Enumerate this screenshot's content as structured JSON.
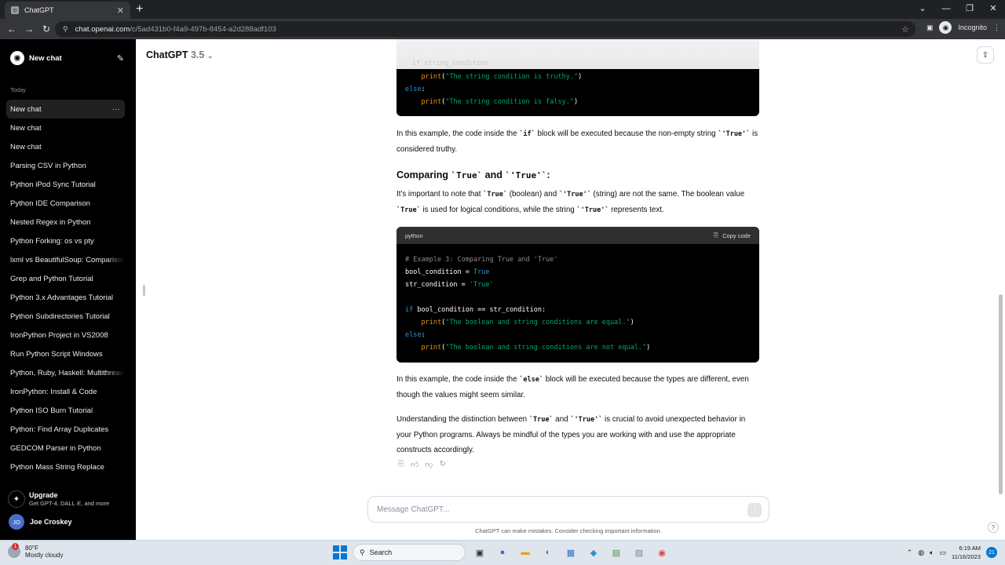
{
  "browser": {
    "tab_title": "ChatGPT",
    "url_host": "chat.openai.com",
    "url_path": "/c/5ad431b0-f4a9-497b-8454-a2d288adf103",
    "incognito_label": "Incognito"
  },
  "sidebar": {
    "new_chat": "New chat",
    "section_label": "Today",
    "items": [
      {
        "label": "New chat"
      },
      {
        "label": "New chat"
      },
      {
        "label": "New chat"
      },
      {
        "label": "Parsing CSV in Python"
      },
      {
        "label": "Python iPod Sync Tutorial"
      },
      {
        "label": "Python IDE Comparison"
      },
      {
        "label": "Nested Regex in Python"
      },
      {
        "label": "Python Forking: os vs pty"
      },
      {
        "label": "lxml vs BeautifulSoup: Comparison"
      },
      {
        "label": "Grep and Python Tutorial"
      },
      {
        "label": "Python 3.x Advantages Tutorial"
      },
      {
        "label": "Python Subdirectories Tutorial"
      },
      {
        "label": "IronPython Project in VS2008"
      },
      {
        "label": "Run Python Script Windows"
      },
      {
        "label": "Python, Ruby, Haskell: Multithreading"
      },
      {
        "label": "IronPython: Install & Code"
      },
      {
        "label": "Python ISO Burn Tutorial"
      },
      {
        "label": "Python: Find Array Duplicates"
      },
      {
        "label": "GEDCOM Parser in Python"
      },
      {
        "label": "Python Mass String Replace"
      }
    ],
    "upgrade_title": "Upgrade",
    "upgrade_sub": "Get GPT-4, DALL·E, and more",
    "user_initials": "JO",
    "user_name": "Joe Croskey"
  },
  "header": {
    "model": "ChatGPT",
    "version": "3.5"
  },
  "message": {
    "code1": {
      "ghost": "if string_condition:",
      "line1_fn": "print",
      "line1_str": "\"The string condition is truthy.\"",
      "line2_kw": "else",
      "line3_fn": "print",
      "line3_str": "\"The string condition is falsy.\""
    },
    "para1": {
      "a": "In this example, the code inside the ",
      "code_a": "`if`",
      "b": " block will be executed because the non-empty string ",
      "code_b": "`'True'`",
      "c": " is considered truthy."
    },
    "heading": {
      "a": "Comparing ",
      "code_a": "`True`",
      "b": " and ",
      "code_b": "`'True'`",
      "c": ":"
    },
    "para2": {
      "a": "It's important to note that ",
      "code_a": "`True`",
      "b": " (boolean) and ",
      "code_b": "`'True'`",
      "c": " (string) are not the same. The boolean value ",
      "code_c": "`True`",
      "d": " is used for logical conditions, while the string ",
      "code_d": "`'True'`",
      "e": " represents text."
    },
    "code2": {
      "language": "python",
      "copy_label": "Copy code",
      "comment": "# Example 3: Comparing True and 'True'",
      "l2_var": "bool_condition = ",
      "l2_val": "True",
      "l3_var": "str_condition = ",
      "l3_val": "'True'",
      "l5_kw": "if",
      "l5_rest": " bool_condition == str_condition:",
      "l6_fn": "print",
      "l6_str": "\"The boolean and string conditions are equal.\"",
      "l7_kw": "else",
      "l8_fn": "print",
      "l8_str": "\"The boolean and string conditions are not equal.\""
    },
    "para3": {
      "a": "In this example, the code inside the ",
      "code_a": "`else`",
      "b": " block will be executed because the types are different, even though the values might seem similar."
    },
    "para4": {
      "a": "Understanding the distinction between ",
      "code_a": "`True`",
      "b": " and ",
      "code_b": "`'True'`",
      "c": " is crucial to avoid unexpected behavior in your Python programs. Always be mindful of the types you are working with and use the appropriate constructs accordingly."
    }
  },
  "composer": {
    "placeholder": "Message ChatGPT...",
    "disclaimer": "ChatGPT can make mistakes. Consider checking important information."
  },
  "taskbar": {
    "temp": "80°F",
    "weather": "Mostly cloudy",
    "weather_badge": "1",
    "search": "Search",
    "time": "6:19 AM",
    "date": "11/16/2023",
    "notif_count": "21"
  },
  "icons": {
    "accent": "#0078d4",
    "code_keyword": "#2e95d3",
    "code_string": "#00a67d",
    "code_function": "#e9950c"
  }
}
